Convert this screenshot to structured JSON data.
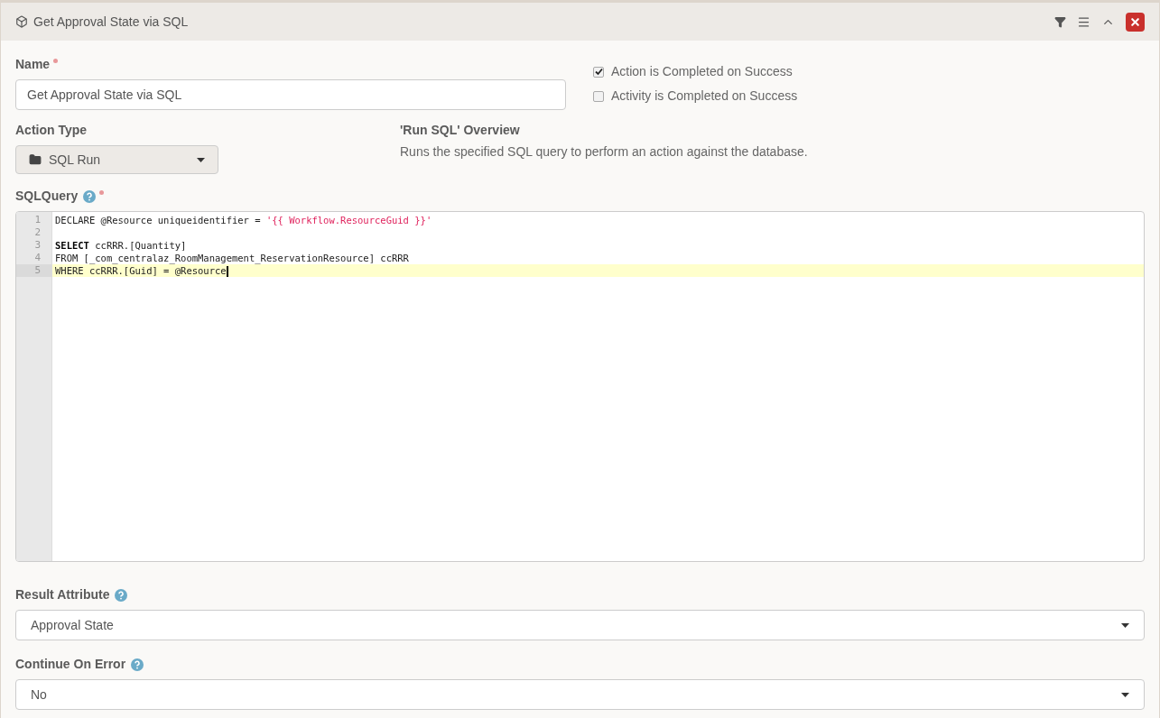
{
  "panel": {
    "title": "Get Approval State via SQL"
  },
  "name_field": {
    "label": "Name",
    "required": true,
    "value": "Get Approval State via SQL"
  },
  "options": [
    {
      "label": "Action is Completed on Success",
      "checked": true
    },
    {
      "label": "Activity is Completed on Success",
      "checked": false
    }
  ],
  "action_type": {
    "label": "Action Type",
    "value": "SQL Run"
  },
  "overview": {
    "title": "'Run SQL' Overview",
    "text": "Runs the specified SQL query to perform an action against the database."
  },
  "sql_query": {
    "label": "SQLQuery",
    "required": true,
    "help": true,
    "lines": [
      {
        "number": "1",
        "active": false,
        "tokens": [
          {
            "kind": "plain",
            "text": "DECLARE @Resource uniqueidentifier = "
          },
          {
            "kind": "string",
            "text": "'{{ Workflow.ResourceGuid }}'"
          }
        ]
      },
      {
        "number": "2",
        "active": false
      },
      {
        "number": "3",
        "active": false,
        "tokens": [
          {
            "kind": "keyword",
            "text": "SELECT"
          },
          {
            "kind": "plain",
            "text": " ccRRR.[Quantity]"
          }
        ]
      },
      {
        "number": "4",
        "active": false,
        "tokens": [
          {
            "kind": "plain",
            "text": "FROM [_com_centralaz_RoomManagement_ReservationResource] ccRRR"
          }
        ]
      },
      {
        "number": "5",
        "active": true,
        "tokens": [
          {
            "kind": "plain",
            "text": "WHERE ccRRR.[Guid] = @Resource"
          }
        ]
      }
    ]
  },
  "result_attribute": {
    "label": "Result Attribute",
    "help": true,
    "value": "Approval State"
  },
  "continue_on_error": {
    "label": "Continue On Error",
    "help": true,
    "value": "No"
  }
}
